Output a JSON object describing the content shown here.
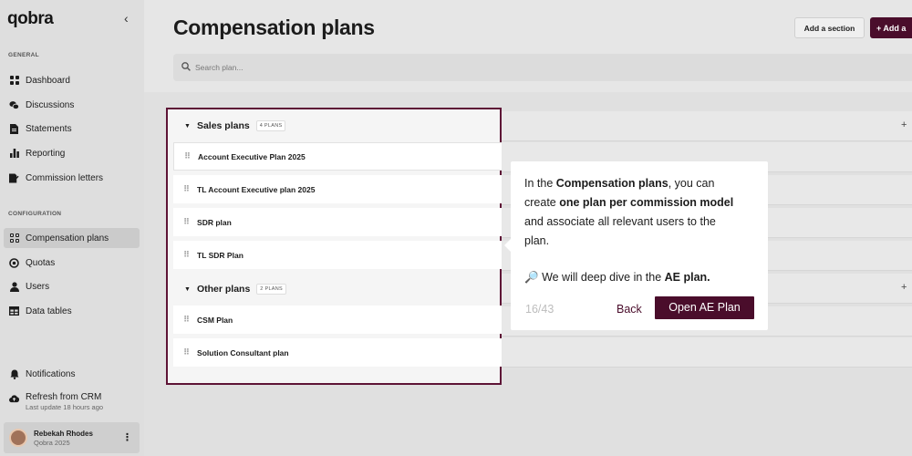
{
  "sidebar": {
    "logo": "qobra",
    "collapse_icon": "chevron-left-icon",
    "general_label": "GENERAL",
    "general_items": [
      {
        "label": "Dashboard",
        "icon": "dashboard-grid-icon"
      },
      {
        "label": "Discussions",
        "icon": "chat-bubbles-icon"
      },
      {
        "label": "Statements",
        "icon": "document-icon"
      },
      {
        "label": "Reporting",
        "icon": "bar-chart-icon"
      },
      {
        "label": "Commission letters",
        "icon": "signature-icon"
      }
    ],
    "config_label": "CONFIGURATION",
    "config_items": [
      {
        "label": "Compensation plans",
        "icon": "plans-grid-icon",
        "active": true
      },
      {
        "label": "Quotas",
        "icon": "target-icon"
      },
      {
        "label": "Users",
        "icon": "user-icon"
      },
      {
        "label": "Data tables",
        "icon": "table-icon"
      }
    ],
    "notifications": "Notifications",
    "refresh": {
      "label": "Refresh from CRM",
      "sub": "Last update 18 hours ago"
    },
    "user": {
      "name": "Rebekah Rhodes",
      "org": "Qobra 2025"
    }
  },
  "header": {
    "title": "Compensation plans",
    "add_section": "Add a section",
    "add_button": "+  Add a"
  },
  "search": {
    "placeholder": "Search plan..."
  },
  "groups": [
    {
      "name": "Sales plans",
      "count": "4 PLANS",
      "plans": [
        "Account Executive Plan 2025",
        "TL Account Executive plan 2025",
        "SDR plan",
        "TL SDR Plan"
      ]
    },
    {
      "name": "Other plans",
      "count": "2 PLANS",
      "plans": [
        "CSM Plan",
        "Solution Consultant plan"
      ]
    }
  ],
  "tooltip": {
    "l1a": "In the ",
    "l1b": "Compensation plans",
    "l1c": ", you can",
    "l2a": "create ",
    "l2b": "one plan per commission model",
    "l3": "and associate all relevant users to the",
    "l4": "plan.",
    "p2_icon": "🔎",
    "p2a": "We will deep dive in the ",
    "p2b": "AE plan.",
    "counter": "16/43",
    "back": "Back",
    "open": "Open AE Plan"
  },
  "colors": {
    "brand": "#4a0d2b",
    "highlight_border": "#5e1436"
  }
}
